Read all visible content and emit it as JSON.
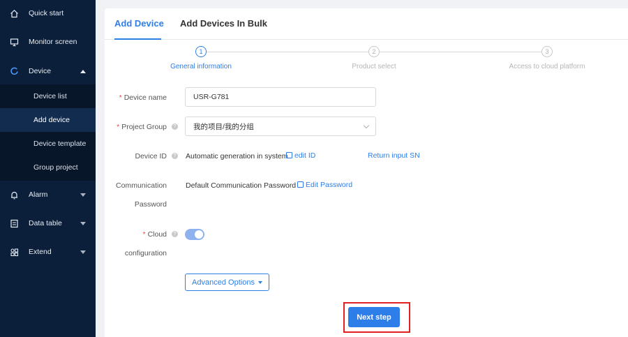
{
  "sidebar": {
    "items": [
      {
        "label": "Quick start",
        "icon": "home-icon"
      },
      {
        "label": "Monitor screen",
        "icon": "monitor-icon"
      },
      {
        "label": "Device",
        "icon": "device-icon"
      },
      {
        "label": "Alarm",
        "icon": "bell-icon"
      },
      {
        "label": "Data table",
        "icon": "table-icon"
      },
      {
        "label": "Extend",
        "icon": "grid-icon"
      }
    ],
    "device_submenu": [
      "Device list",
      "Add device",
      "Device template",
      "Group project"
    ],
    "active_submenu": "Add device"
  },
  "tabs": {
    "active": "Add Device",
    "inactive": "Add Devices In Bulk"
  },
  "steps": [
    {
      "number": "1",
      "label": "General information"
    },
    {
      "number": "2",
      "label": "Product select"
    },
    {
      "number": "3",
      "label": "Access to cloud platform"
    }
  ],
  "form": {
    "required_mark": "*",
    "help_mark": "?",
    "device_name": {
      "label": "Device name",
      "value": "USR-G781"
    },
    "project_group": {
      "label": "Project Group",
      "value": "我的项目/我的分组"
    },
    "device_id": {
      "label": "Device ID",
      "value": "Automatic generation in system",
      "edit_link": "edit ID",
      "alt_link": "Return input SN"
    },
    "comm_password": {
      "label_line1": "Communication",
      "label_line2": "Password",
      "value": "Default Communication Password",
      "edit_link": "Edit Password"
    },
    "cloud_config": {
      "label_line1": "Cloud",
      "label_line2": "configuration",
      "enabled": true
    }
  },
  "advanced_options_label": "Advanced Options",
  "next_step_label": "Next step",
  "colors": {
    "accent": "#2d7ee8",
    "sidebar_bg": "#0b1f3a",
    "highlight": "#e02020"
  }
}
